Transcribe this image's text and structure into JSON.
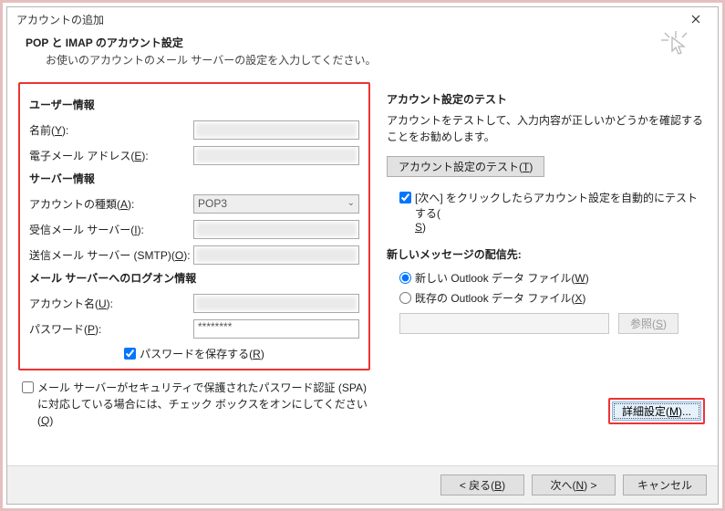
{
  "window": {
    "title": "アカウントの追加"
  },
  "header": {
    "title": "POP と IMAP のアカウント設定",
    "subtitle": "お使いのアカウントのメール サーバーの設定を入力してください。"
  },
  "left": {
    "user_section": "ユーザー情報",
    "name_label_pre": "名前(",
    "name_label_key": "Y",
    "name_label_post": "):",
    "email_label_pre": "電子メール アドレス(",
    "email_label_key": "E",
    "email_label_post": "):",
    "server_section": "サーバー情報",
    "acct_type_label_pre": "アカウントの種類(",
    "acct_type_label_key": "A",
    "acct_type_label_post": "):",
    "acct_type_value": "POP3",
    "incoming_label_pre": "受信メール サーバー(",
    "incoming_label_key": "I",
    "incoming_label_post": "):",
    "outgoing_label_pre": "送信メール サーバー (SMTP)(",
    "outgoing_label_key": "O",
    "outgoing_label_post": "):",
    "logon_section": "メール サーバーへのログオン情報",
    "account_label_pre": "アカウント名(",
    "account_label_key": "U",
    "account_label_post": "):",
    "password_label_pre": "パスワード(",
    "password_label_key": "P",
    "password_label_post": "):",
    "password_value": "********",
    "remember_pw_pre": "パスワードを保存する(",
    "remember_pw_key": "R",
    "remember_pw_post": ")",
    "spa_pre": "メール サーバーがセキュリティで保護されたパスワード認証 (SPA) に対応している場合には、チェック ボックスをオンにしてください(",
    "spa_key": "Q",
    "spa_post": ")"
  },
  "right": {
    "test_title": "アカウント設定のテスト",
    "test_desc": "アカウントをテストして、入力内容が正しいかどうかを確認することをお勧めします。",
    "test_btn_pre": "アカウント設定のテスト(",
    "test_btn_key": "T",
    "test_btn_post": ")",
    "auto_test_pre": "[次へ] をクリックしたらアカウント設定を自動的にテストする(",
    "auto_test_key": "S",
    "auto_test_post": ")",
    "deliver_title": "新しいメッセージの配信先:",
    "radio_new_pre": "新しい Outlook データ ファイル(",
    "radio_new_key": "W",
    "radio_new_post": ")",
    "radio_exist_pre": "既存の Outlook データ ファイル(",
    "radio_exist_key": "X",
    "radio_exist_post": ")",
    "browse_pre": "参照(",
    "browse_key": "S",
    "browse_post": ")",
    "more_pre": "詳細設定(",
    "more_key": "M",
    "more_post": ")..."
  },
  "footer": {
    "back_pre": "< 戻る(",
    "back_key": "B",
    "back_post": ")",
    "next_pre": "次へ(",
    "next_key": "N",
    "next_post": ") >",
    "cancel": "キャンセル"
  }
}
